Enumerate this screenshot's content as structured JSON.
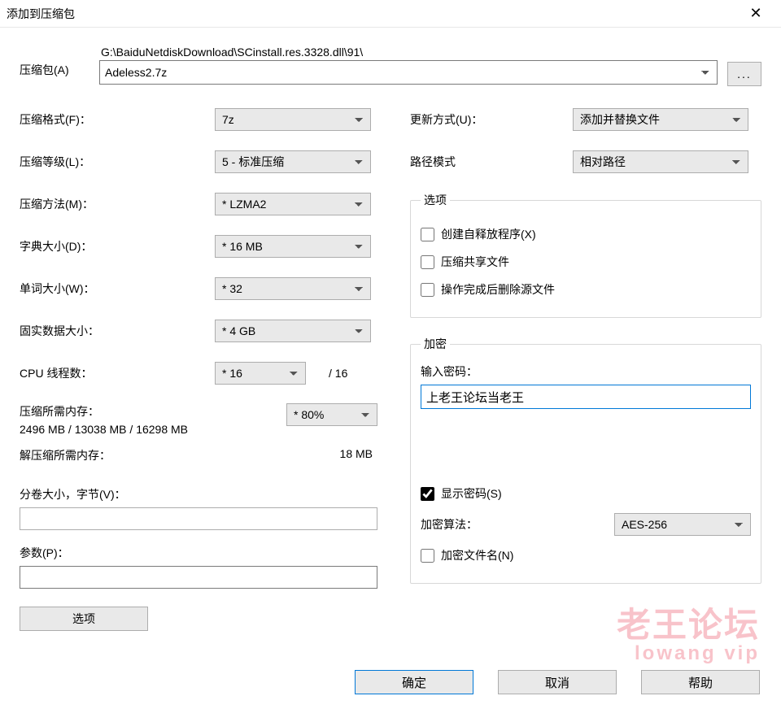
{
  "window": {
    "title": "添加到压缩包",
    "close": "✕"
  },
  "archive": {
    "label": "压缩包(A)",
    "path": "G:\\BaiduNetdiskDownload\\SCinstall.res.3328.dll\\91\\",
    "name": "Adeless2.7z",
    "browse": "..."
  },
  "left": {
    "format": {
      "label": "压缩格式(F)：",
      "value": "7z"
    },
    "level": {
      "label": "压缩等级(L)：",
      "value": "5 - 标准压缩"
    },
    "method": {
      "label": "压缩方法(M)：",
      "value": "* LZMA2"
    },
    "dict": {
      "label": "字典大小(D)：",
      "value": "* 16 MB"
    },
    "word": {
      "label": "单词大小(W)：",
      "value": "* 32"
    },
    "solid": {
      "label": "固实数据大小：",
      "value": "* 4 GB"
    },
    "threads": {
      "label": "CPU 线程数：",
      "value": "* 16",
      "total": "/ 16"
    },
    "mem": {
      "label": "压缩所需内存：",
      "value": "2496 MB / 13038 MB / 16298 MB",
      "ratio": "* 80%"
    },
    "decompress": {
      "label": "解压缩所需内存：",
      "value": "18 MB"
    },
    "split": {
      "label": "分卷大小，字节(V)：",
      "value": ""
    },
    "params": {
      "label": "参数(P)：",
      "value": ""
    },
    "options_btn": "选项"
  },
  "right": {
    "update": {
      "label": "更新方式(U)：",
      "value": "添加并替换文件"
    },
    "pathmode": {
      "label": "路径模式",
      "value": "相对路径"
    },
    "options": {
      "legend": "选项",
      "sfx": "创建自释放程序(X)",
      "shared": "压缩共享文件",
      "delete": "操作完成后删除源文件"
    },
    "encryption": {
      "legend": "加密",
      "pwd_label": "输入密码：",
      "pwd_value": "上老王论坛当老王",
      "show_pwd": "显示密码(S)",
      "alg_label": "加密算法：",
      "alg_value": "AES-256",
      "enc_names": "加密文件名(N)"
    }
  },
  "watermark": {
    "main": "老王论坛",
    "sub": "lowang vip"
  },
  "buttons": {
    "ok": "确定",
    "cancel": "取消",
    "help": "帮助"
  }
}
